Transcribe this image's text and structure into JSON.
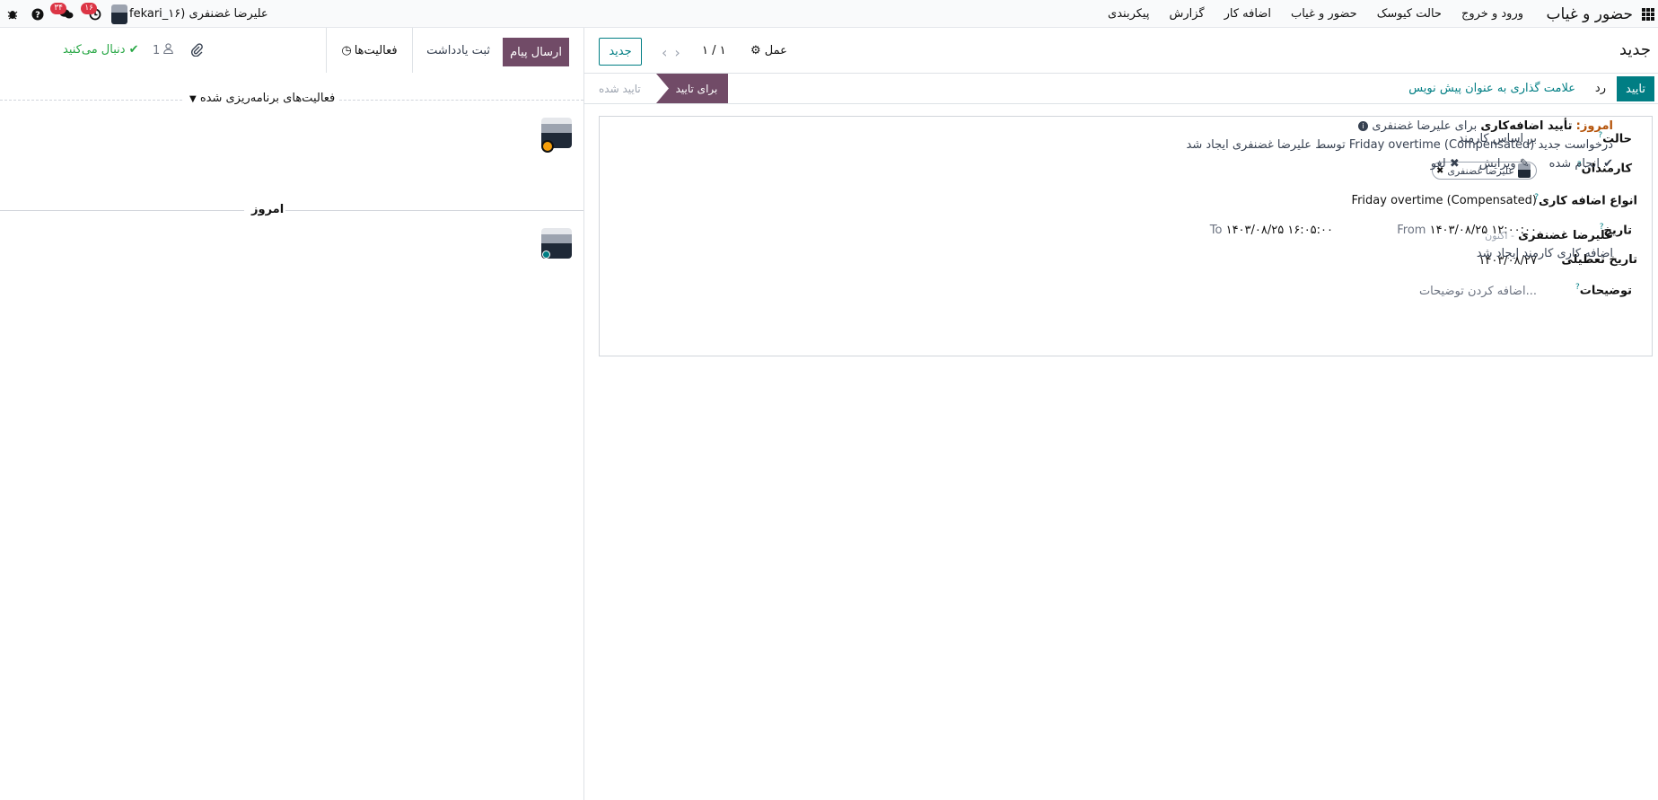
{
  "navbar": {
    "brand": "حضور و غیاب",
    "menu": [
      "ورود و خروج",
      "حالت کیوسک",
      "حضور و غیاب",
      "اضافه کار",
      "گزارش",
      "پیکربندی"
    ],
    "user_label": "علیرضا غضنفری (fekari_۱۶",
    "activity_count": "۱۶",
    "messages_count": "۳۴",
    "icons": [
      "apps-grid-icon",
      "bug-icon",
      "help-icon",
      "chat-icon",
      "clock-icon"
    ]
  },
  "control_panel": {
    "title": "جدید",
    "new_button": "جدید",
    "pager": "۱ / ۱",
    "action": "عمل"
  },
  "statusbar": {
    "confirm_button": "تایید",
    "refuse_button": "رد",
    "draft_button": "علامت گذاری به عنوان پیش نویس",
    "stage_active": "برای تایید",
    "stage_done": "تایید شده"
  },
  "form": {
    "state_label": "حالت",
    "state_value": "بر اساس کارمند",
    "employees_label": "کارمندان",
    "employee_tag": "علیرضا غضنفری",
    "overtime_type_label": "انواع اضافه کاری",
    "overtime_type_value": "Friday overtime (Compensated)",
    "date_label": "تاریخ",
    "from_label": "From",
    "date_from": "۱۴۰۳/۰۸/۲۵ ۱۲:۰۰:۰۰",
    "to_label": "To",
    "date_to": "۱۴۰۳/۰۸/۲۵ ۱۶:۰۵:۰۰",
    "holiday_label": "تاریخ تعطیلی",
    "holiday_value": "۱۴۰۳/۰۸/۲۷",
    "description_label": "توضیحات",
    "description_placeholder": "اضافه کردن توضیحات..."
  },
  "chatter": {
    "send_message": "ارسال پیام",
    "log_note": "ثبت یادداشت",
    "activities": "فعالیت‌ها",
    "followers_count": "1",
    "follow_link": "دنبال می‌کنید",
    "scheduled_title": "فعالیت‌های برنامه‌ریزی شده",
    "activity": {
      "today": "امروز:",
      "summary": "تأیید اضافه‌کاری",
      "for_user": "برای علیرضا غضنفری",
      "note": "درخواست جدید Friday overtime (Compensated) توسط علیرضا غضنفری ایجاد شد",
      "mark_done": "انجام شده",
      "edit": "ویرایش",
      "cancel": "لغو"
    },
    "today_separator": "امروز",
    "message": {
      "author": "علیرضا غضنفری",
      "time": "- اکنون",
      "body": "اضافه کاری کارمند ایجاد شد"
    }
  }
}
